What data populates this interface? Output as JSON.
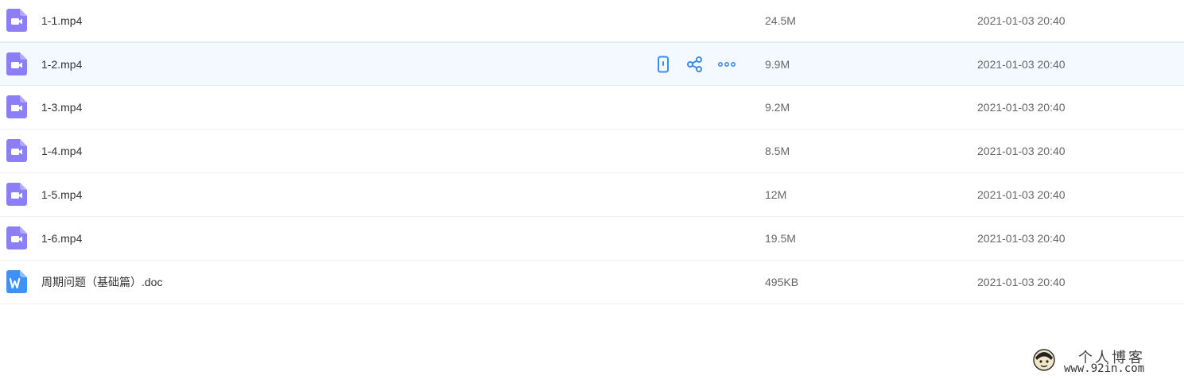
{
  "files": [
    {
      "name": "1-1.mp4",
      "size": "24.5M",
      "date": "2021-01-03 20:40",
      "icon": "video-file-icon"
    },
    {
      "name": "1-2.mp4",
      "size": "9.9M",
      "date": "2021-01-03 20:40",
      "icon": "video-file-icon"
    },
    {
      "name": "1-3.mp4",
      "size": "9.2M",
      "date": "2021-01-03 20:40",
      "icon": "video-file-icon"
    },
    {
      "name": "1-4.mp4",
      "size": "8.5M",
      "date": "2021-01-03 20:40",
      "icon": "video-file-icon"
    },
    {
      "name": "1-5.mp4",
      "size": "12M",
      "date": "2021-01-03 20:40",
      "icon": "video-file-icon"
    },
    {
      "name": "1-6.mp4",
      "size": "19.5M",
      "date": "2021-01-03 20:40",
      "icon": "video-file-icon"
    },
    {
      "name": "周期问题（基础篇）.doc",
      "size": "495KB",
      "date": "2021-01-03 20:40",
      "icon": "word-file-icon"
    }
  ],
  "row_actions": [
    "phone-icon",
    "share-icon",
    "more-icon"
  ],
  "colors": {
    "video_icon": "#8c7ff5",
    "word_icon": "#3e91f7",
    "action_blue": "#3b8cf0",
    "hover_bg": "#f3f9ff"
  },
  "watermark": {
    "title": "个人博客",
    "url": "www.92in.com"
  }
}
